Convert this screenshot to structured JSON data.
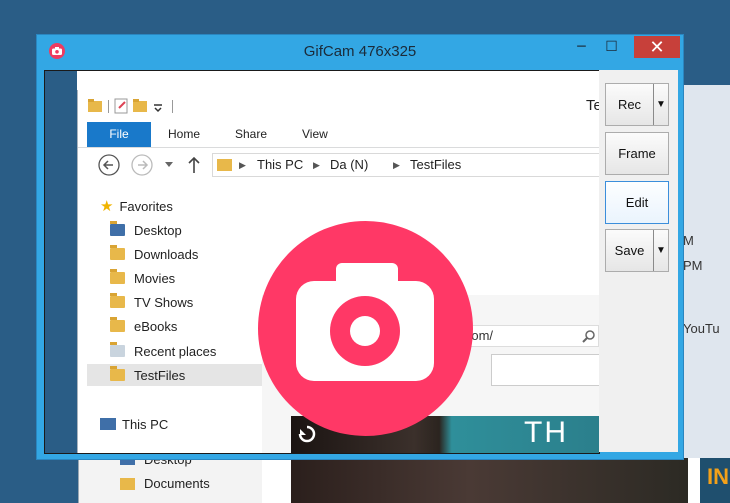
{
  "window": {
    "title": "GifCam 476x325",
    "minimize": "─",
    "maximize": "☐",
    "close": "✕"
  },
  "side_buttons": {
    "rec": "Rec",
    "frame": "Frame",
    "edit": "Edit",
    "save": "Save"
  },
  "explorer": {
    "title_partial": "Te",
    "ribbon_tabs": [
      "File",
      "Home",
      "Share",
      "View"
    ],
    "address": {
      "this_pc": "This PC",
      "drive": "Da (N)",
      "folder": "TestFiles"
    },
    "nav": {
      "favorites": "Favorites",
      "items": [
        "Desktop",
        "Downloads",
        "Movies",
        "TV Shows",
        "eBooks",
        "Recent places",
        "TestFiles"
      ],
      "this_pc": "This PC",
      "pc_items": [
        "Desktop",
        "Documents"
      ]
    },
    "web": {
      "url": "youtube.com/",
      "video_text": "TH"
    }
  },
  "background": {
    "right_text": [
      "M",
      "PM",
      "YouTu"
    ],
    "banner": "IN"
  },
  "colors": {
    "accent": "#33a7e4",
    "camera": "#ff3866",
    "close": "#c7403a"
  }
}
